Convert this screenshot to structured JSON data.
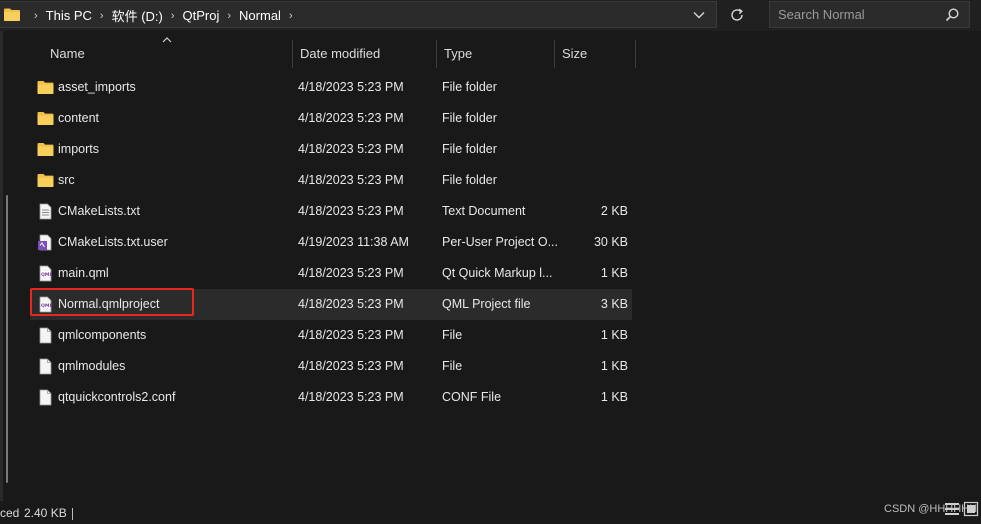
{
  "address": {
    "crumbs": [
      "This PC",
      "软件 (D:)",
      "QtProj",
      "Normal"
    ],
    "separator": "›"
  },
  "search": {
    "placeholder": "Search Normal"
  },
  "columns": {
    "name": "Name",
    "date": "Date modified",
    "type": "Type",
    "size": "Size"
  },
  "files": [
    {
      "name": "asset_imports",
      "date": "4/18/2023 5:23 PM",
      "type": "File folder",
      "size": "",
      "icon": "folder-icon"
    },
    {
      "name": "content",
      "date": "4/18/2023 5:23 PM",
      "type": "File folder",
      "size": "",
      "icon": "folder-icon"
    },
    {
      "name": "imports",
      "date": "4/18/2023 5:23 PM",
      "type": "File folder",
      "size": "",
      "icon": "folder-icon"
    },
    {
      "name": "src",
      "date": "4/18/2023 5:23 PM",
      "type": "File folder",
      "size": "",
      "icon": "folder-icon"
    },
    {
      "name": "CMakeLists.txt",
      "date": "4/18/2023 5:23 PM",
      "type": "Text Document",
      "size": "2 KB",
      "icon": "text-file-icon"
    },
    {
      "name": "CMakeLists.txt.user",
      "date": "4/19/2023 11:38 AM",
      "type": "Per-User Project O...",
      "size": "30 KB",
      "icon": "user-project-file-icon"
    },
    {
      "name": "main.qml",
      "date": "4/18/2023 5:23 PM",
      "type": "Qt Quick Markup l...",
      "size": "1 KB",
      "icon": "qml-file-icon"
    },
    {
      "name": "Normal.qmlproject",
      "date": "4/18/2023 5:23 PM",
      "type": "QML Project file",
      "size": "3 KB",
      "icon": "qml-file-icon"
    },
    {
      "name": "qmlcomponents",
      "date": "4/18/2023 5:23 PM",
      "type": "File",
      "size": "1 KB",
      "icon": "blank-file-icon"
    },
    {
      "name": "qmlmodules",
      "date": "4/18/2023 5:23 PM",
      "type": "File",
      "size": "1 KB",
      "icon": "blank-file-icon"
    },
    {
      "name": "qtquickcontrols2.conf",
      "date": "4/18/2023 5:23 PM",
      "type": "CONF File",
      "size": "1 KB",
      "icon": "blank-file-icon"
    }
  ],
  "hover_row": "Normal.qmlproject",
  "status": {
    "selected": "ced",
    "size": "2.40 KB"
  },
  "watermark": "CSDN @HHHHHH",
  "colors": {
    "folder": "#f2c046",
    "highlight": "#e8271e",
    "background": "#191919"
  }
}
